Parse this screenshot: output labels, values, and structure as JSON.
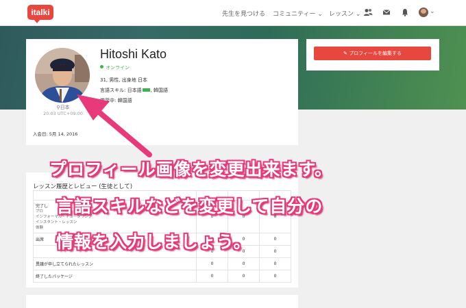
{
  "nav": {
    "logo": "italki",
    "find_teacher": "先生を見つける",
    "community": "コミュニティー",
    "lessons": "レッスン"
  },
  "profile": {
    "name": "Hitoshi Kato",
    "status": "オンライン",
    "age_line": "31, 男性, 出身地 日本",
    "language_skill_label": "言語スキル:",
    "native_language": "日本語",
    "other_language": ", 韓国語",
    "learning_label": "学習中:",
    "learning_language": "韓国語",
    "location": "日本",
    "local_time": "20:03 UTC+09:00",
    "joined": "入会日: 5月 14, 2016"
  },
  "actions": {
    "edit_profile": "プロフィールを編集する"
  },
  "history": {
    "title": "レッスン履歴とレビュー (生徒として)",
    "rows": [
      {
        "label": "",
        "sub": [],
        "values": [
          "",
          "",
          ""
        ]
      },
      {
        "label": "完了し",
        "sub": [
          "プロ",
          "インフォーマル・チュータリング",
          "インスタント・レッスン",
          "体験"
        ],
        "values": [
          "0",
          "0",
          "0"
        ]
      },
      {
        "label": "出席",
        "sub": [],
        "values": [
          "0",
          "0",
          "0"
        ]
      },
      {
        "label": "",
        "sub": [],
        "values": [
          "0",
          "0",
          "0"
        ]
      },
      {
        "label": "異議が申し立てられたレッスン",
        "sub": [],
        "values": [
          "0",
          "0",
          "0"
        ]
      },
      {
        "label": "終了したパッケージ",
        "sub": [],
        "values": [
          "0",
          "0",
          "0"
        ]
      }
    ]
  },
  "annotation": {
    "line1": "プロフィール画像を変更出来ます。",
    "line2": "言語スキルなどを変更して自分の",
    "line3": "情報を入力しましょう。",
    "color": "#e83a7a"
  },
  "colors": {
    "brand": "#e8473f",
    "online": "#39b54a",
    "hero_start": "#2f5a5c",
    "hero_end": "#4e9150"
  }
}
